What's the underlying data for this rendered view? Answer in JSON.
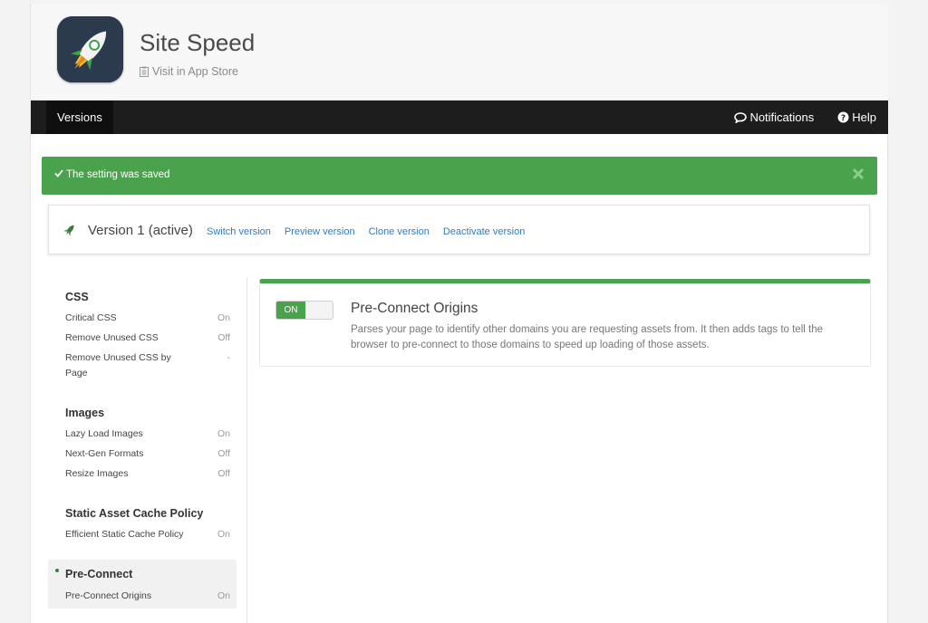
{
  "header": {
    "app_title": "Site Speed",
    "store_link": "Visit in App Store",
    "icon": "rocket-app-icon"
  },
  "navbar": {
    "active_tab": "Versions",
    "notifications": "Notifications",
    "help": "Help"
  },
  "alert": {
    "message": "The setting was saved",
    "color": "#4aa24c"
  },
  "version": {
    "title": "Version 1 (active)",
    "links": [
      "Switch version",
      "Preview version",
      "Clone version",
      "Deactivate version"
    ]
  },
  "sidebar": {
    "groups": [
      {
        "title": "CSS",
        "items": [
          {
            "label": "Critical CSS",
            "state": "On"
          },
          {
            "label": "Remove Unused CSS",
            "state": "Off"
          },
          {
            "label": "Remove Unused CSS by Page",
            "state": "-"
          }
        ]
      },
      {
        "title": "Images",
        "items": [
          {
            "label": "Lazy Load Images",
            "state": "On"
          },
          {
            "label": "Next-Gen Formats",
            "state": "Off"
          },
          {
            "label": "Resize Images",
            "state": "Off"
          }
        ]
      },
      {
        "title": "Static Asset Cache Policy",
        "items": [
          {
            "label": "Efficient Static Cache Policy",
            "state": "On"
          }
        ]
      },
      {
        "title": "Pre-Connect",
        "items": [
          {
            "label": "Pre-Connect Origins",
            "state": "On"
          }
        ]
      }
    ]
  },
  "setting": {
    "toggle_label": "ON",
    "title": "Pre-Connect Origins",
    "description": "Parses your page to identify other domains you are requesting assets from. It then adds tags to tell the browser to pre-connect to those domains to speed up loading of those assets."
  },
  "colors": {
    "accent": "#4aa24c",
    "link": "#2f7bbf",
    "navbar": "#1d1d1d"
  }
}
